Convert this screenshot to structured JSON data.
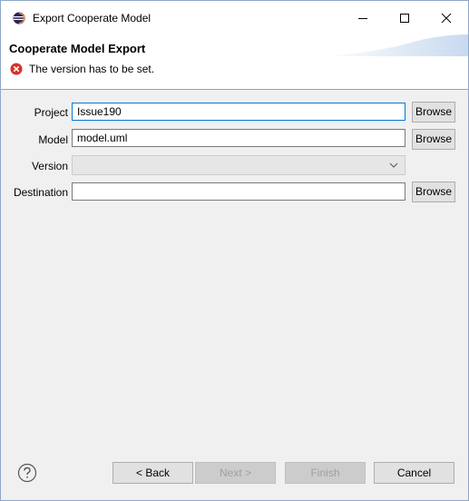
{
  "window": {
    "title": "Export Cooperate Model"
  },
  "banner": {
    "title": "Cooperate Model Export",
    "error_message": "The version has to be set."
  },
  "form": {
    "project_label": "Project",
    "project_value": "Issue190",
    "model_label": "Model",
    "model_value": "model.uml",
    "version_label": "Version",
    "version_value": "",
    "destination_label": "Destination",
    "destination_value": "",
    "browse_label": "Browse"
  },
  "footer": {
    "back_label": "< Back",
    "next_label": "Next >",
    "finish_label": "Finish",
    "cancel_label": "Cancel"
  },
  "colors": {
    "error": "#d9312b",
    "focus_border": "#0078d7",
    "banner_accent": "#c8daf0"
  }
}
